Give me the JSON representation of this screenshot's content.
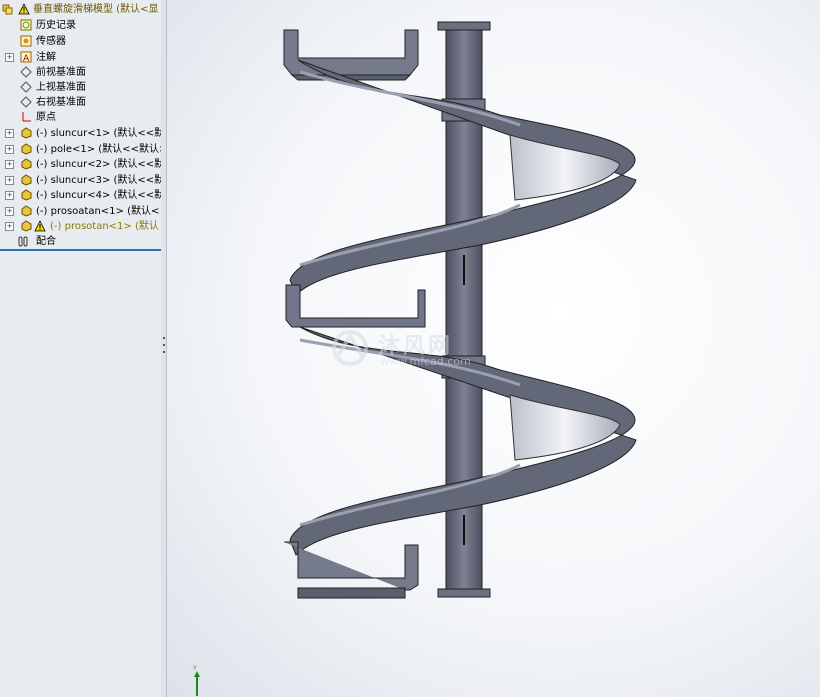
{
  "feature_tree": {
    "items": [
      {
        "label": "垂直螺旋滑梯模型  (默认<显",
        "kind": "root",
        "icon": "assembly-warning-icon"
      },
      {
        "label": "历史记录",
        "kind": "leaf",
        "icon": "history-icon"
      },
      {
        "label": "传感器",
        "kind": "leaf",
        "icon": "sensor-icon"
      },
      {
        "label": "注解",
        "kind": "expand",
        "icon": "annotation-icon"
      },
      {
        "label": "前视基准面",
        "kind": "leaf",
        "icon": "plane-icon"
      },
      {
        "label": "上视基准面",
        "kind": "leaf",
        "icon": "plane-icon"
      },
      {
        "label": "右视基准面",
        "kind": "leaf",
        "icon": "plane-icon"
      },
      {
        "label": "原点",
        "kind": "leaf",
        "icon": "origin-icon"
      },
      {
        "label": "(-) sluncur<1> (默认<<默",
        "kind": "expand",
        "icon": "part-icon"
      },
      {
        "label": "(-) pole<1> (默认<<默认>",
        "kind": "expand",
        "icon": "part-icon"
      },
      {
        "label": "(-) sluncur<2> (默认<<默",
        "kind": "expand",
        "icon": "part-icon"
      },
      {
        "label": "(-) sluncur<3> (默认<<默",
        "kind": "expand",
        "icon": "part-icon"
      },
      {
        "label": "(-) sluncur<4> (默认<<默",
        "kind": "expand",
        "icon": "part-icon"
      },
      {
        "label": "(-) prosoatan<1> (默认<",
        "kind": "expand",
        "icon": "part-icon"
      },
      {
        "label": "(-) prosotan<1> (默认",
        "kind": "expand-warn",
        "icon": "part-warning-icon"
      },
      {
        "label": "配合",
        "kind": "leaf",
        "icon": "mates-icon"
      }
    ]
  },
  "watermark": {
    "text": "沐风网",
    "url": "www.mfcad.com"
  },
  "triad": {
    "axis_label": "Y"
  },
  "colors": {
    "accent": "#2b6fb5",
    "part": "#5e6370",
    "part_light": "#8a8fa0",
    "warning": "#e6c200"
  }
}
